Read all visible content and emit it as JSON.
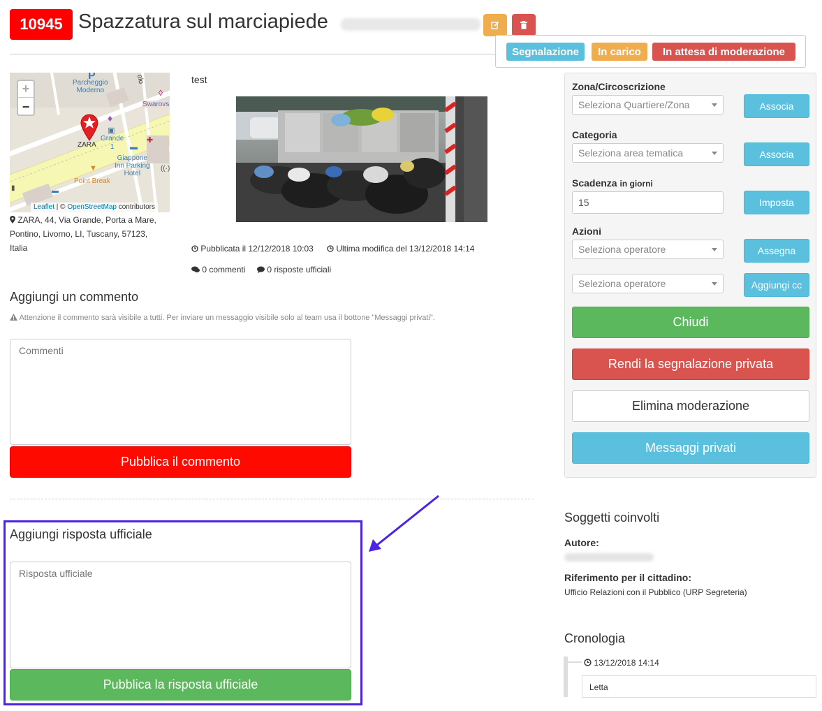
{
  "header": {
    "report_id": "10945",
    "title": "Spazzatura sul marciapiede",
    "edit_icon": "edit-icon",
    "delete_icon": "trash-icon"
  },
  "status": {
    "type": "Segnalazione",
    "state": "In carico",
    "moderation": "In attesa di moderazione",
    "colors": {
      "info": "#5bc0de",
      "warning": "#f0ad4e",
      "danger": "#d9534f"
    }
  },
  "map": {
    "zoom_in": "+",
    "zoom_out": "−",
    "labels": {
      "parking": "Parcheggio\nModerno",
      "swarovski": "Swarovs",
      "zara": "ZARA",
      "grande": "Grande",
      "grande_num": "1",
      "hotel": "Giappone\nInn Parking\nHotel",
      "point_break": "Point Break",
      "street": "olo"
    },
    "attribution_leaflet": "Leaflet",
    "attribution_sep": " | © ",
    "attribution_osm": "OpenStreetMap",
    "attribution_tail": " contributors"
  },
  "address": "ZARA, 44, Via Grande, Porta a Mare, Pontino, Livorno, LI, Tuscany, 57123, Italia",
  "description": "test",
  "meta": {
    "published": "Pubblicata il 12/12/2018 10:03",
    "modified": "Ultima modifica del 13/12/2018 14:14",
    "comments": "0 commenti",
    "replies": "0 risposte ufficiali"
  },
  "comment": {
    "heading": "Aggiungi un commento",
    "warning": "Attenzione il commento sarà visibile a tutti. Per inviare un messaggio visibile solo al team usa il bottone \"Messaggi privati\".",
    "placeholder": "Commenti",
    "submit": "Pubblica il commento",
    "submit_color": "#ff0a00"
  },
  "reply": {
    "heading": "Aggiungi risposta ufficiale",
    "placeholder": "Risposta ufficiale",
    "submit": "Pubblica la risposta ufficiale",
    "submit_color": "#5cb85c",
    "highlight_color": "#4b22e6"
  },
  "panel": {
    "zone_label": "Zona/Circoscrizione",
    "zone_select": "Seleziona Quartiere/Zona",
    "zone_button": "Associa",
    "category_label": "Categoria",
    "category_select": "Seleziona area tematica",
    "category_button": "Associa",
    "deadline_label": "Scadenza",
    "deadline_unit": "in giorni",
    "deadline_value": "15",
    "deadline_button": "Imposta",
    "actions_label": "Azioni",
    "operator_select": "Seleziona operatore",
    "assign_button": "Assegna",
    "cc_select": "Seleziona operatore",
    "cc_button": "Aggiungi cc",
    "close_button": "Chiudi",
    "private_button": "Rendi la segnalazione privata",
    "remove_moderation_button": "Elimina moderazione",
    "messages_button": "Messaggi privati"
  },
  "involved": {
    "heading": "Soggetti coinvolti",
    "author_label": "Autore:",
    "reference_label": "Riferimento per il cittadino:",
    "reference_value": "Ufficio Relazioni con il Pubblico (URP Segreteria)"
  },
  "timeline": {
    "heading": "Cronologia",
    "date": "13/12/2018 14:14",
    "entry": "Letta"
  }
}
